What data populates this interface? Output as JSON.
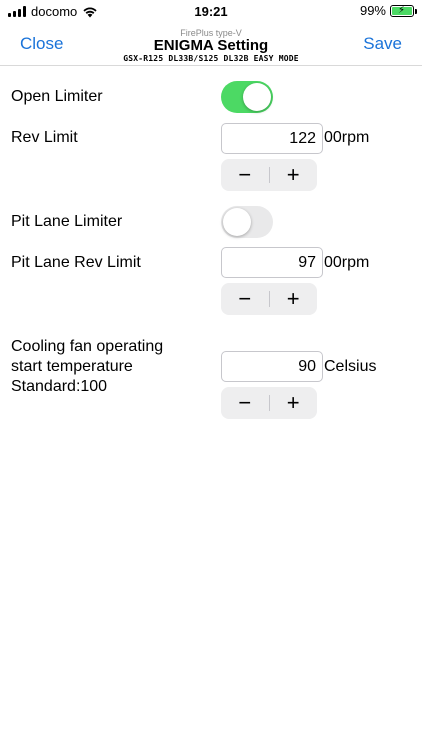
{
  "status_bar": {
    "carrier": "docomo",
    "time": "19:21",
    "battery_percent": "99%",
    "battery_level": 0.99,
    "icons": [
      "signal-icon",
      "wifi-icon",
      "battery-charging-icon"
    ]
  },
  "nav": {
    "close_label": "Close",
    "save_label": "Save",
    "subtitle": "FirePlus type-V",
    "title": "ENIGMA Setting",
    "mode": "GSX-R125 DL33B/S125 DL32B EASY MODE"
  },
  "settings": {
    "open_limiter": {
      "label": "Open Limiter",
      "enabled": true
    },
    "rev_limit": {
      "label": "Rev Limit",
      "value": "122",
      "unit": "00rpm",
      "minus": "−",
      "plus": "+"
    },
    "pit_lane_limiter": {
      "label": "Pit Lane Limiter",
      "enabled": false
    },
    "pit_lane_rev_limit": {
      "label": "Pit Lane Rev Limit",
      "value": "97",
      "unit": "00rpm",
      "minus": "−",
      "plus": "+"
    },
    "cooling_fan": {
      "label_line1": "Cooling fan operating",
      "label_line2": "start temperature",
      "label_line3": "Standard:100",
      "value": "90",
      "unit": "Celsius",
      "minus": "−",
      "plus": "+"
    }
  },
  "colors": {
    "accent": "#1a73d9",
    "toggle_on": "#4cd964",
    "toggle_off": "#e9e9ea"
  }
}
